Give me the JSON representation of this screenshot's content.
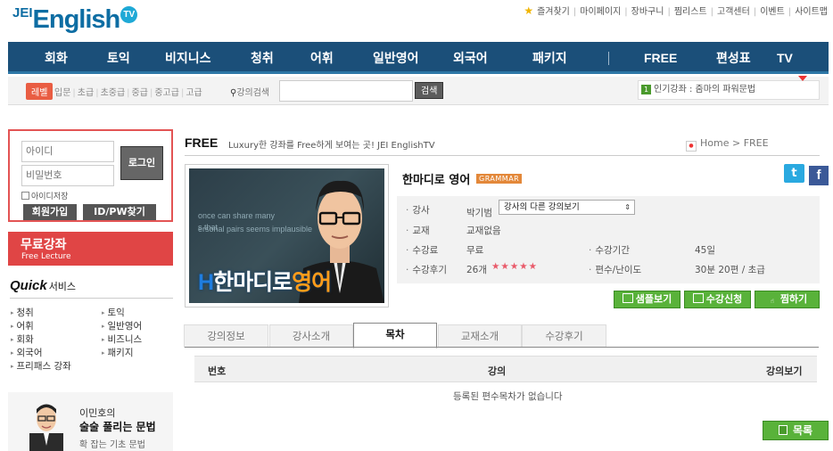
{
  "logo": {
    "jei": "JEI",
    "english": "English",
    "tv": "TV"
  },
  "toplinks": [
    "즐겨찾기",
    "마이페이지",
    "장바구니",
    "찜리스트",
    "고객센터",
    "이벤트",
    "사이트맵"
  ],
  "nav": [
    "회화",
    "토익",
    "비지니스",
    "청취",
    "어휘",
    "일반영어",
    "외국어",
    "패키지",
    "FREE",
    "편성표",
    "TV"
  ],
  "subbar": {
    "level_label": "레벨",
    "levels": [
      "입문",
      "초급",
      "초중급",
      "중급",
      "중고급",
      "고급"
    ],
    "search_label": "강의검색",
    "search_placeholder": "",
    "search_button": "검색",
    "popular_num": "1",
    "popular_text": "인기강좌 : 줌마의 파워문법"
  },
  "login": {
    "id_placeholder": "아이디",
    "pw_placeholder": "비밀번호",
    "login_button": "로그인",
    "save_id": "아이디저장",
    "join": "회원가입",
    "find": "ID/PW찾기"
  },
  "free_lecture": {
    "title": "무료강좌",
    "subtitle": "Free Lecture"
  },
  "quick": {
    "title": "Quick",
    "subtitle": "서비스",
    "left": [
      "청취",
      "어휘",
      "회화",
      "외국어",
      "프리패스 강좌"
    ],
    "right": [
      "토익",
      "일반영어",
      "비즈니스",
      "패키지"
    ]
  },
  "promo": {
    "line1": "이민호의",
    "line2": "술술 풀리는 문법",
    "line3": "확 잡는 기초 문법"
  },
  "page": {
    "title": "FREE",
    "subtitle": "Luxury한 강좌를 Free하게 보여는 곳! JEI EnglishTV",
    "breadcrumb": "Home > FREE"
  },
  "thumb": {
    "board_lines": [
      "once can share many",
      "s that",
      "ersonal pairs seems implausible"
    ],
    "logo_h": "H",
    "logo_main": "한마디로",
    "logo_accent": "영어"
  },
  "course": {
    "title": "한마디로 영어",
    "badge": "GRAMMAR",
    "teacher_label": "강사",
    "teacher": "박기범",
    "teacher_select": "강사의 다른 강의보기",
    "book_label": "교재",
    "book": "교재없음",
    "fee_label": "수강료",
    "fee": "무료",
    "period_label": "수강기간",
    "period": "45일",
    "review_label": "수강후기",
    "review_count": "26개",
    "rating": 5,
    "stars": "★★★★★",
    "episodes_label": "편수/난이도",
    "episodes": "30분 20편 / 초급"
  },
  "buttons": {
    "sample": "샘플보기",
    "apply": "수강신청",
    "wish": "찜하기",
    "list": "목록"
  },
  "tabs": [
    {
      "label": "강의정보",
      "active": false
    },
    {
      "label": "강사소개",
      "active": false
    },
    {
      "label": "목차",
      "active": true
    },
    {
      "label": "교재소개",
      "active": false
    },
    {
      "label": "수강후기",
      "active": false
    }
  ],
  "toc": {
    "columns": [
      "번호",
      "강의",
      "강의보기"
    ],
    "empty": "등록된 편수목차가 없습니다"
  },
  "colors": {
    "nav": "#1b4f79",
    "accent_red": "#e04545",
    "green": "#59b23a"
  }
}
